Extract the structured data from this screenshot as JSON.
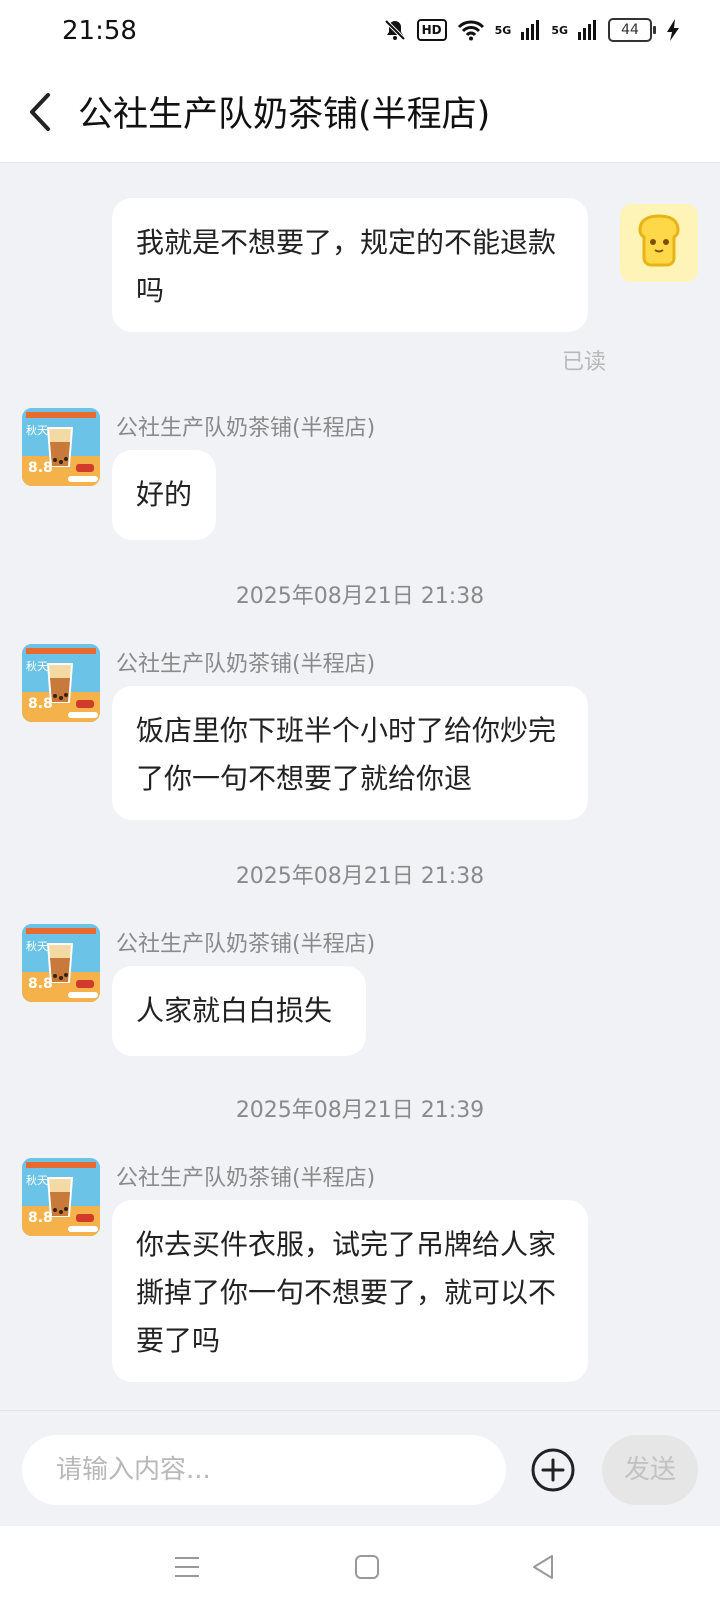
{
  "status_bar": {
    "time": "21:58",
    "hd_label": "HD",
    "signal1_label": "5G",
    "signal2_label": "5G",
    "battery": "44",
    "icons": [
      "bell-off-icon",
      "wifi-icon",
      "signal-icon",
      "battery-icon",
      "charging-icon"
    ]
  },
  "header": {
    "title": "公社生产队奶茶铺(半程店)",
    "back_icon": "chevron-left-icon"
  },
  "messages": {
    "m1": {
      "text": "我就是不想要了，规定的不能退款吗",
      "read_status": "已读"
    },
    "m2": {
      "sender": "公社生产队奶茶铺(半程店)",
      "text": "好的"
    },
    "t1": "2025年08月21日 21:38",
    "m3": {
      "sender": "公社生产队奶茶铺(半程店)",
      "text": "饭店里你下班半个小时了给你炒完了你一句不想要了就给你退"
    },
    "t2": "2025年08月21日 21:38",
    "m4": {
      "sender": "公社生产队奶茶铺(半程店)",
      "text": "人家就白白损失"
    },
    "t3": "2025年08月21日 21:39",
    "m5": {
      "sender": "公社生产队奶茶铺(半程店)",
      "text": "你去买件衣服，试完了吊牌给人家撕掉了你一句不想要了，就可以不要了吗"
    }
  },
  "shop_avatar": {
    "badge": "8.8",
    "tagline": "秋天"
  },
  "input_bar": {
    "placeholder": "请输入内容...",
    "send_label": "发送",
    "plus_icon": "plus-circle-icon"
  },
  "nav_bar": {
    "icons": [
      "menu-icon",
      "home-square-icon",
      "back-triangle-icon"
    ]
  },
  "colors": {
    "background": "#f0f2f5",
    "bubble": "#ffffff",
    "user_avatar": "#ffd84a"
  }
}
